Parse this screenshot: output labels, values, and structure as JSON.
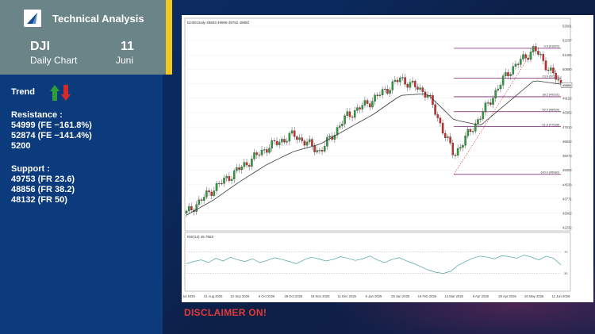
{
  "header": {
    "app_title": "Technical Analysis",
    "symbol": "DJI",
    "chart_label": "Daily Chart",
    "day": "11",
    "month": "Juni"
  },
  "sidebar": {
    "trend_label": "Trend",
    "resistance_label": "Resistance :",
    "resistance": [
      "54999 (FE −161.8%)",
      "52874 (FE −141.4%)",
      "5200"
    ],
    "support_label": "Support :",
    "support": [
      "49753 (FR 23.6)",
      "48856 (FR 38.2)",
      "48132 (FR 50)"
    ]
  },
  "chart_header": "DJI30.Daily 49803 49908 49752 49850",
  "disclaimer": "DISCLAIMER ON!",
  "colors": {
    "trend_up": "#2e9e3a",
    "trend_down": "#d42a2a",
    "fib": "#7a1f6e",
    "ma": "#3a3a3a"
  },
  "chart_data": {
    "type": "candlestick",
    "x_ticks": [
      "30 Jul 2025",
      "21 Aug 2025",
      "12 Sep 2025",
      "6 Oct 2025",
      "28 Oct 2025",
      "19 Nov 2025",
      "11 Dec 2025",
      "6 Jan 2026",
      "28 Jan 2026",
      "19 Feb 2026",
      "13 Mar 2026",
      "6 Apr 2026",
      "28 Apr 2026",
      "20 May 2026",
      "11 Jun 2026"
    ],
    "y_ticks": [
      53001,
      52237,
      51464,
      50690,
      49917,
      49152,
      48382,
      47610,
      46842,
      46073,
      45302,
      44536,
      43771,
      43002,
      42232
    ],
    "ylim": [
      42232,
      53001
    ],
    "current_price": 49850,
    "close_path": [
      {
        "x": "30 Jul 2025",
        "y": 43000
      },
      {
        "x": "21 Aug 2025",
        "y": 44300
      },
      {
        "x": "12 Sep 2025",
        "y": 45400
      },
      {
        "x": "6 Oct 2025",
        "y": 46500
      },
      {
        "x": "28 Oct 2025",
        "y": 47200
      },
      {
        "x": "19 Nov 2025",
        "y": 46300
      },
      {
        "x": "11 Dec 2025",
        "y": 48200
      },
      {
        "x": "6 Jan 2026",
        "y": 49100
      },
      {
        "x": "28 Jan 2026",
        "y": 50200
      },
      {
        "x": "19 Feb 2026",
        "y": 49400
      },
      {
        "x": "13 Mar 2026",
        "y": 46100
      },
      {
        "x": "6 Apr 2026",
        "y": 48200
      },
      {
        "x": "28 Apr 2026",
        "y": 50500
      },
      {
        "x": "20 May 2026",
        "y": 51800
      },
      {
        "x": "11 Jun 2026",
        "y": 49850
      }
    ],
    "ma_path": [
      {
        "x": "30 Jul 2025",
        "y": 42900
      },
      {
        "x": "21 Aug 2025",
        "y": 43700
      },
      {
        "x": "12 Sep 2025",
        "y": 44700
      },
      {
        "x": "6 Oct 2025",
        "y": 45600
      },
      {
        "x": "28 Oct 2025",
        "y": 46300
      },
      {
        "x": "19 Nov 2025",
        "y": 46700
      },
      {
        "x": "11 Dec 2025",
        "y": 47500
      },
      {
        "x": "6 Jan 2026",
        "y": 48300
      },
      {
        "x": "28 Jan 2026",
        "y": 49300
      },
      {
        "x": "19 Feb 2026",
        "y": 49400
      },
      {
        "x": "13 Mar 2026",
        "y": 48000
      },
      {
        "x": "6 Apr 2026",
        "y": 47700
      },
      {
        "x": "28 Apr 2026",
        "y": 48900
      },
      {
        "x": "20 May 2026",
        "y": 50100
      },
      {
        "x": "11 Jun 2026",
        "y": 49900
      }
    ],
    "fib_levels": [
      {
        "label": "0.0 (51820)",
        "value": 51820
      },
      {
        "label": "23.6 (50218)",
        "value": 50218
      },
      {
        "label": "38.2 (49231)",
        "value": 49231
      },
      {
        "label": "50.0 (48434)",
        "value": 48434
      },
      {
        "label": "61.8 (47638)",
        "value": 47638
      },
      {
        "label": "100.0 (45082)",
        "value": 45082
      }
    ],
    "fib_start_x": "13 Mar 2026",
    "rsi": {
      "label": "RSI(14) 45.7653",
      "levels": [
        70,
        30
      ],
      "ylim": [
        0,
        100
      ],
      "values": [
        48,
        52,
        55,
        50,
        58,
        53,
        60,
        55,
        52,
        57,
        50,
        54,
        59,
        56,
        52,
        48,
        55,
        60,
        57,
        53,
        56,
        61,
        58,
        54,
        57,
        62,
        55,
        50,
        56,
        59,
        53,
        48,
        42,
        36,
        32,
        30,
        34,
        45,
        52,
        58,
        62,
        60,
        57,
        63,
        61,
        58,
        64,
        60,
        55,
        62,
        58,
        46
      ]
    }
  }
}
